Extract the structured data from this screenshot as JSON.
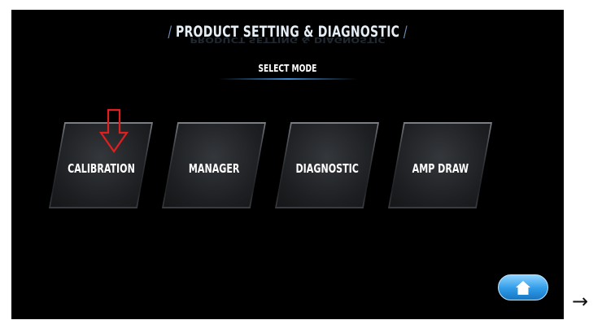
{
  "header": {
    "title": "PRODUCT SETTING & DIAGNOSTIC",
    "subtitle": "SELECT MODE"
  },
  "modes": [
    {
      "label": "CALIBRATION"
    },
    {
      "label": "MANAGER"
    },
    {
      "label": "DIAGNOSTIC"
    },
    {
      "label": "AMP DRAW"
    }
  ],
  "icons": {
    "pointer": "red-down-arrow-icon",
    "home": "home-icon",
    "next": "right-arrow-icon"
  },
  "outer_arrow": "→",
  "colors": {
    "background": "#000000",
    "accent_blue": "#2f9be8",
    "annotation_red": "#e02020",
    "text": "#ffffff"
  }
}
